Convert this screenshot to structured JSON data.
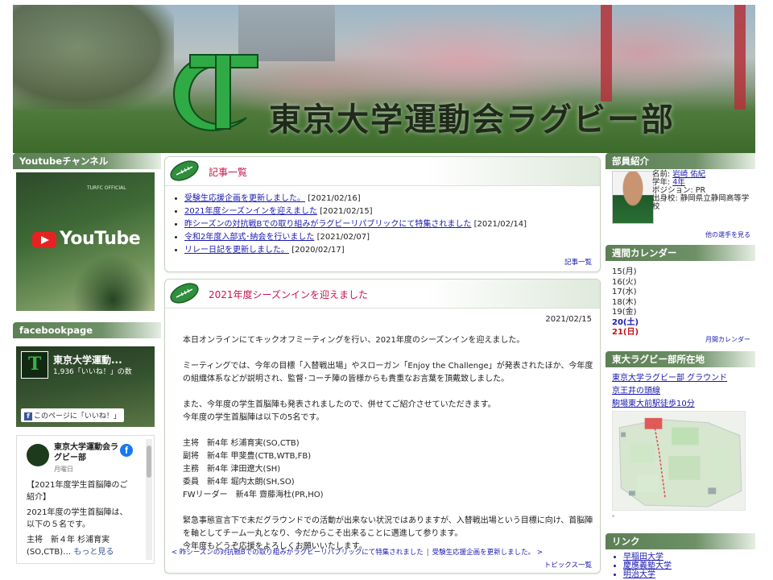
{
  "site": {
    "title": "東京大学運動会ラグビー部",
    "accent": "#c9154b",
    "brand_green": "#5c7f55",
    "link": "#1a1ab0"
  },
  "left": {
    "youtube_heading": "Youtubeチャンネル",
    "youtube_thumb": {
      "brand": "YouTube",
      "tag": "TURFC OFFICIAL"
    },
    "facebook_heading": "facebookpage",
    "fb_widget": {
      "name": "東京大学運動...",
      "likes": "1,936「いいね！」の数",
      "like_button": "このページに「いいね！」"
    },
    "fb_post": {
      "page_name": "東京大学運動会ラグビー部",
      "date": "月曜日",
      "lines": [
        "【2021年度学生首脳陣のご紹介】",
        "2021年度の学生首脳陣は、以下の５名です。",
        "主将　新４年 杉浦育実(SO,CTB)…"
      ],
      "more": "もっと見る"
    }
  },
  "news": {
    "title": "記事一覧",
    "items": [
      {
        "text": "受験生応援企画を更新しました。",
        "date": "[2021/02/16]"
      },
      {
        "text": "2021年度シーズンインを迎えました",
        "date": "[2021/02/15]"
      },
      {
        "text": "昨シーズンの対抗戦Bでの取り組みがラグビーリパブリックにて特集されました",
        "date": "[2021/02/14]"
      },
      {
        "text": "令和2年度入部式･納会を行いました",
        "date": "[2021/02/07]"
      },
      {
        "text": "リレー日記を更新しました。",
        "date": "[2020/02/17]"
      }
    ],
    "more": "記事一覧"
  },
  "article": {
    "title": "2021年度シーズンインを迎えました",
    "date": "2021/02/15",
    "p1": "本日オンラインにてキックオフミーティングを行い、2021年度のシーズンインを迎えました。",
    "p2": "ミーティングでは、今年の目標「入替戦出場」やスローガン「Enjoy the Challenge」が発表されたほか、今年度の組織体系などが説明され、監督･コーチ陣の皆様からも貴重なお言葉を頂戴致しました。",
    "p3": "また、今年度の学生首脳陣も発表されましたので、併せてご紹介させていただきます。",
    "p3b": "今年度の学生首脳陣は以下の5名です。",
    "roster": [
      "主将　新4年 杉浦育実(SO,CTB)",
      "副将　新4年 甲斐豊(CTB,WTB,FB)",
      "主務　新4年 津田遼大(SH)",
      "委員　新4年 堀内太朗(SH,SO)",
      "FWリーダー　新4年 齋藤海杜(PR,HO)"
    ],
    "p4": "緊急事態宣言下で未だグラウンドでの活動が出来ない状況ではありますが、入替戦出場という目標に向け、首脳陣を軸としてチーム一丸となり、今だからこそ出来ることに邁進して参ります。",
    "p5": "今年度もどうぞ応援をよろしくお願いいたします。",
    "prev": "< 昨シーズンの対抗戦Bでの取り組みがラグビーリパブリックにて特集されました",
    "next": "受験生応援企画を更新しました。 >",
    "topics": "トピックス一覧"
  },
  "right": {
    "profile_heading": "部員紹介",
    "profile": {
      "name_label": "名前:",
      "name": "岩崎 佑紀",
      "grade_label": "学年:",
      "grade": "4年",
      "position": "ポジション: PR",
      "school": "出身校: 静岡県立静岡高等学校",
      "more": "他の選手を見る"
    },
    "calendar_heading": "週間カレンダー",
    "calendar": {
      "days": [
        "15(月)",
        "16(火)",
        "17(水)",
        "18(木)",
        "19(金)"
      ],
      "sat": "20(土)",
      "sun": "21(日)",
      "more": "月間カレンダー"
    },
    "location_heading": "東大ラグビー部所在地",
    "location": {
      "lines": [
        "東京大学ラグビー部 グラウンド",
        "京王井の頭線",
        "駒場東大前駅徒歩10分"
      ],
      "dash": "-"
    },
    "links_heading": "リンク",
    "links": [
      "早稲田大学",
      "慶應義塾大学",
      "明治大学"
    ]
  }
}
